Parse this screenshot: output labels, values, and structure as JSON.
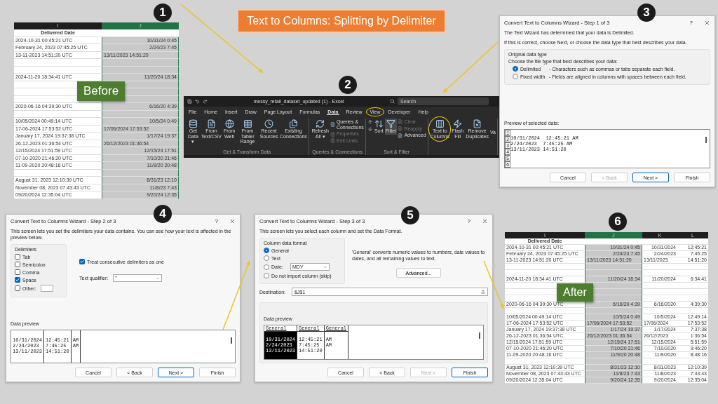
{
  "before": {
    "step": "1",
    "badge": "Before",
    "columns": [
      {
        "name": "I",
        "selected": false
      },
      {
        "name": "J",
        "selected": true
      }
    ],
    "header": "Delivered Date",
    "rows": [
      {
        "kind": "data",
        "cells": [
          {
            "text": "2024-10-31 00:45:21 UTC",
            "kind": "text"
          },
          {
            "text": "10/31/24 0:45",
            "kind": "number"
          }
        ]
      },
      {
        "kind": "data",
        "cells": [
          {
            "text": "February 24, 2023 07:45:25 UTC",
            "kind": "text"
          },
          {
            "text": "2/24/23 7:45",
            "kind": "number"
          }
        ]
      },
      {
        "kind": "data",
        "cells": [
          {
            "text": "13-11-2023 14:51:20 UTC",
            "kind": "text"
          },
          {
            "text": "13/11/2023 14:51:20",
            "kind": "text"
          }
        ]
      },
      {
        "kind": "blank"
      },
      {
        "kind": "blank"
      },
      {
        "kind": "data",
        "cells": [
          {
            "text": "2024-11-20 18:34:41 UTC",
            "kind": "text"
          },
          {
            "text": "11/20/24 18:34",
            "kind": "number"
          }
        ]
      },
      {
        "kind": "blank"
      },
      {
        "kind": "blank"
      },
      {
        "kind": "blank"
      },
      {
        "kind": "data",
        "cells": [
          {
            "text": "2020-06-16 04:39:30 UTC",
            "kind": "text"
          },
          {
            "text": "6/16/20 4:39",
            "kind": "number"
          }
        ]
      },
      {
        "kind": "blank"
      },
      {
        "kind": "data",
        "cells": [
          {
            "text": "10/05/2024 00:49:14 UTC",
            "kind": "text"
          },
          {
            "text": "10/5/24 0:49",
            "kind": "number"
          }
        ]
      },
      {
        "kind": "data",
        "cells": [
          {
            "text": "17-06-2024 17:53:52 UTC",
            "kind": "text"
          },
          {
            "text": "17/06/2024 17:53:52",
            "kind": "text"
          }
        ]
      },
      {
        "kind": "data",
        "cells": [
          {
            "text": "January 17, 2024 19:37:38 UTC",
            "kind": "text"
          },
          {
            "text": "1/17/24 19:37",
            "kind": "number"
          }
        ]
      },
      {
        "kind": "data",
        "cells": [
          {
            "text": "26-12-2023 01:36:54 UTC",
            "kind": "text"
          },
          {
            "text": "26/12/2023 01:36:54",
            "kind": "text"
          }
        ]
      },
      {
        "kind": "data",
        "cells": [
          {
            "text": "12/15/2024 17:51:59 UTC",
            "kind": "text"
          },
          {
            "text": "12/15/24 17:51",
            "kind": "number"
          }
        ]
      },
      {
        "kind": "data",
        "cells": [
          {
            "text": "07-10-2020 21:46:20 UTC",
            "kind": "text"
          },
          {
            "text": "7/10/20 21:46",
            "kind": "number"
          }
        ]
      },
      {
        "kind": "data",
        "cells": [
          {
            "text": "11-09-2020 20:48:16 UTC",
            "kind": "text"
          },
          {
            "text": "11/9/20 20:48",
            "kind": "number"
          }
        ]
      },
      {
        "kind": "blank"
      },
      {
        "kind": "data",
        "cells": [
          {
            "text": "August 31, 2023 12:10:39 UTC",
            "kind": "text"
          },
          {
            "text": "8/31/23 12:10",
            "kind": "number"
          }
        ]
      },
      {
        "kind": "data",
        "cells": [
          {
            "text": "November 08, 2023 07:43:43 UTC",
            "kind": "text"
          },
          {
            "text": "11/8/23 7:43",
            "kind": "number"
          }
        ]
      },
      {
        "kind": "data",
        "cells": [
          {
            "text": "09/20/2024 12:35:04 UTC",
            "kind": "text"
          },
          {
            "text": "9/20/24 12:35",
            "kind": "number"
          }
        ]
      }
    ]
  },
  "title": "Text to Columns: Splitting by Delimiter",
  "excel": {
    "step": "2",
    "window_title": "messy_retail_dataset_updated (1) - Excel",
    "search_placeholder": "Search",
    "tabs": [
      {
        "label": "File",
        "selected": false,
        "highlighted": false
      },
      {
        "label": "Home",
        "selected": false,
        "highlighted": false
      },
      {
        "label": "Insert",
        "selected": false,
        "highlighted": false
      },
      {
        "label": "Draw",
        "selected": false,
        "highlighted": false
      },
      {
        "label": "Page Layout",
        "selected": false,
        "highlighted": false
      },
      {
        "label": "Formulas",
        "selected": false,
        "highlighted": false
      },
      {
        "label": "Data",
        "selected": true,
        "highlighted": false
      },
      {
        "label": "Review",
        "selected": false,
        "highlighted": false
      },
      {
        "label": "View",
        "selected": false,
        "highlighted": true
      },
      {
        "label": "Developer",
        "selected": false,
        "highlighted": false
      },
      {
        "label": "Help",
        "selected": false,
        "highlighted": false
      }
    ],
    "groups": [
      {
        "label": "Get & Transform Data",
        "items": [
          {
            "kind": "large",
            "label": "Get Data ▾",
            "selected": false,
            "disabled": false,
            "highlighted": false
          },
          {
            "kind": "large",
            "label": "From Text/CSV",
            "selected": false,
            "disabled": false,
            "highlighted": false
          },
          {
            "kind": "large",
            "label": "From Web",
            "selected": false,
            "disabled": false,
            "highlighted": false
          },
          {
            "kind": "large",
            "label": "From Table/ Range",
            "selected": false,
            "disabled": false,
            "highlighted": false
          },
          {
            "kind": "large",
            "label": "Recent Sources",
            "selected": false,
            "disabled": false,
            "highlighted": false
          },
          {
            "kind": "large",
            "label": "Existing Connections",
            "selected": false,
            "disabled": false,
            "highlighted": false
          }
        ]
      },
      {
        "label": "Queries & Connections",
        "items": [
          {
            "kind": "large",
            "label": "Refresh All ▾",
            "selected": false,
            "disabled": false,
            "highlighted": false
          },
          {
            "kind": "stack",
            "entries": [
              {
                "label": "Queries & Connections",
                "disabled": false
              },
              {
                "label": "Properties",
                "disabled": true
              },
              {
                "label": "Edit Links",
                "disabled": true
              }
            ]
          }
        ]
      },
      {
        "label": "Sort & Filter",
        "items": [
          {
            "kind": "sort_buttons"
          },
          {
            "kind": "large",
            "label": "Sort",
            "selected": false,
            "disabled": false,
            "highlighted": false
          },
          {
            "kind": "large",
            "label": "Filter",
            "selected": true,
            "disabled": false,
            "highlighted": false
          },
          {
            "kind": "stack",
            "entries": [
              {
                "label": "Clear",
                "disabled": true
              },
              {
                "label": "Reapply",
                "disabled": true
              },
              {
                "label": "Advanced",
                "disabled": false
              }
            ]
          }
        ]
      },
      {
        "items": [
          {
            "kind": "large",
            "label": "Text to Columns",
            "selected": false,
            "disabled": false,
            "highlighted": true
          },
          {
            "kind": "large",
            "label": "Flash Fill",
            "selected": false,
            "disabled": false,
            "highlighted": false
          },
          {
            "kind": "large",
            "label": "Remove Duplicates",
            "selected": false,
            "disabled": false,
            "highlighted": false
          },
          {
            "kind": "cut",
            "label": "Va"
          }
        ]
      }
    ]
  },
  "step1_dialog": {
    "step": "3",
    "title": "Convert Text to Columns Wizard - Step 1 of 3",
    "help": "?",
    "intro": [
      "The Text Wizard has determined that your data is Delimited.",
      "If this is correct, choose Next, or choose the data type that best describes your data."
    ],
    "group_label": "Original data type",
    "prompt": "Choose the file type that best describes your data:",
    "options": [
      {
        "label": "Delimited",
        "description": "- Characters such as commas or tabs separate each field.",
        "selected": true
      },
      {
        "label": "Fixed width",
        "description": "- Fields are aligned in columns with spaces between each field.",
        "selected": false
      }
    ],
    "preview_label": "Preview of selected data:",
    "preview_lines": [
      {
        "number": "1"
      },
      {
        "number": "2",
        "text": "10/31/2024  12:45:21 AM"
      },
      {
        "number": "3",
        "text": "2/24/2023  7:45:25 AM"
      },
      {
        "number": "4",
        "text": "13/11/2023 14:51:20"
      },
      {
        "number": "5"
      },
      {
        "number": "6"
      }
    ],
    "buttons": [
      {
        "label": "Cancel",
        "disabled": false,
        "default": false
      },
      {
        "label": "< Back",
        "disabled": true,
        "default": false
      },
      {
        "label": "Next >",
        "disabled": false,
        "default": true
      },
      {
        "label": "Finish",
        "disabled": false,
        "default": false
      }
    ]
  },
  "step2_dialog": {
    "step": "4",
    "title": "Convert Text to Columns Wizard - Step 2 of 3",
    "help": "?",
    "intro": "This screen lets you set the delimiters your data contains.  You can see how your text is affected in the preview below.",
    "group_label": "Delimiters",
    "delimiters": [
      {
        "label": "Tab",
        "checked": false,
        "kind": "plain"
      },
      {
        "label": "Semicolon",
        "checked": false,
        "kind": "plain"
      },
      {
        "label": "Comma",
        "checked": false,
        "kind": "plain"
      },
      {
        "label": "Space",
        "checked": true,
        "kind": "plain"
      },
      {
        "label": "Other:",
        "checked": false,
        "kind": "other"
      }
    ],
    "consecutive": {
      "label": "Treat consecutive delimiters as one",
      "checked": true
    },
    "qualifier": {
      "label": "Text qualifier:",
      "value": "\""
    },
    "preview_label": "Data preview",
    "preview_columns": [
      [
        "10/31/2024",
        "2/24/2023",
        "13/11/2023"
      ],
      [
        "12:45:21",
        "7:45:25",
        "14:51:20"
      ],
      [
        "AM",
        "AM"
      ]
    ],
    "buttons": [
      {
        "label": "Cancel",
        "disabled": false,
        "default": false
      },
      {
        "label": "< Back",
        "disabled": false,
        "default": false
      },
      {
        "label": "Next >",
        "disabled": false,
        "default": true
      },
      {
        "label": "Finish",
        "disabled": false,
        "default": false
      }
    ]
  },
  "step3_dialog": {
    "step": "5",
    "title": "Convert Text to Columns Wizard - Step 3 of 3",
    "help": "?",
    "intro": "This screen lets you select each column and set the Data Format.",
    "group_label": "Column data format",
    "formats": [
      {
        "label": "General",
        "selected": true,
        "kind": "plain"
      },
      {
        "label": "Text",
        "selected": false,
        "kind": "plain"
      },
      {
        "label": "Date:",
        "selected": false,
        "kind": "date",
        "value": "MDY"
      },
      {
        "label": "Do not import column (skip)",
        "selected": false,
        "kind": "plain"
      }
    ],
    "note": "'General' converts numeric values to numbers, date values to dates, and all remaining values to text.",
    "advanced": "Advanced...",
    "destination": {
      "label": "Destination:",
      "value": "$J$1"
    },
    "preview_label": "Data preview",
    "preview_columns": [
      {
        "header": "General",
        "selected": true,
        "values": [
          "10/31/2024",
          "2/24/2023",
          "13/11/2023"
        ]
      },
      {
        "header": "General",
        "selected": false,
        "values": [
          "12:45:21",
          "7:45:25",
          "14:51:20"
        ]
      },
      {
        "header": "General",
        "selected": false,
        "values": [
          "AM",
          "AM"
        ]
      }
    ],
    "buttons": [
      {
        "label": "Cancel",
        "disabled": false,
        "default": false
      },
      {
        "label": "< Back",
        "disabled": false,
        "default": false
      },
      {
        "label": "Next >",
        "disabled": true,
        "default": false
      },
      {
        "label": "Finish",
        "disabled": false,
        "default": true
      }
    ]
  },
  "after": {
    "step": "6",
    "badge": "After",
    "columns": [
      {
        "name": "I",
        "selected": false
      },
      {
        "name": "J",
        "selected": true
      },
      {
        "name": "K",
        "selected": false
      },
      {
        "name": "L",
        "selected": false
      }
    ],
    "header": "Delivered Date",
    "rows": [
      {
        "kind": "data",
        "cells": [
          {
            "text": "2024-10-31 00:45:21 UTC",
            "kind": "text"
          },
          {
            "text": "10/31/24 0:45",
            "kind": "number"
          },
          {
            "text": "10/31/2024",
            "kind": "number"
          },
          {
            "text": "12:45:21",
            "kind": "number"
          }
        ]
      },
      {
        "kind": "data",
        "cells": [
          {
            "text": "February 24, 2023 07:45:25 UTC",
            "kind": "text"
          },
          {
            "text": "2/24/23 7:45",
            "kind": "number"
          },
          {
            "text": "2/24/2023",
            "kind": "number"
          },
          {
            "text": "7:45:25",
            "kind": "number"
          }
        ]
      },
      {
        "kind": "data",
        "cells": [
          {
            "text": "13-11-2023 14:51:20 UTC",
            "kind": "text"
          },
          {
            "text": "13/11/2023 14:51:20",
            "kind": "text"
          },
          {
            "text": "13/11/2023",
            "kind": "text"
          },
          {
            "text": "14:51:20",
            "kind": "number"
          }
        ]
      },
      {
        "kind": "blank"
      },
      {
        "kind": "blank"
      },
      {
        "kind": "data",
        "cells": [
          {
            "text": "2024-11-20 18:34:41 UTC",
            "kind": "text"
          },
          {
            "text": "11/20/24 18:34",
            "kind": "number"
          },
          {
            "text": "11/20/2024",
            "kind": "number"
          },
          {
            "text": "6:34:41",
            "kind": "number"
          }
        ]
      },
      {
        "kind": "blank"
      },
      {
        "kind": "blank"
      },
      {
        "kind": "blank"
      },
      {
        "kind": "data",
        "cells": [
          {
            "text": "2020-06-16 04:39:30 UTC",
            "kind": "text"
          },
          {
            "text": "6/16/20 4:39",
            "kind": "number"
          },
          {
            "text": "6/16/2020",
            "kind": "number"
          },
          {
            "text": "4:39:30",
            "kind": "number"
          }
        ]
      },
      {
        "kind": "blank"
      },
      {
        "kind": "data",
        "cells": [
          {
            "text": "10/05/2024 00:49:14 UTC",
            "kind": "text"
          },
          {
            "text": "10/5/24 0:49",
            "kind": "number"
          },
          {
            "text": "10/5/2024",
            "kind": "number"
          },
          {
            "text": "12:49:14",
            "kind": "number"
          }
        ]
      },
      {
        "kind": "data",
        "cells": [
          {
            "text": "17-06-2024 17:53:52 UTC",
            "kind": "text"
          },
          {
            "text": "17/06/2024 17:53:52",
            "kind": "text"
          },
          {
            "text": "17/06/2024",
            "kind": "text"
          },
          {
            "text": "17:53:52",
            "kind": "number"
          }
        ]
      },
      {
        "kind": "data",
        "cells": [
          {
            "text": "January 17, 2024 19:37:38 UTC",
            "kind": "text"
          },
          {
            "text": "1/17/24 19:37",
            "kind": "number"
          },
          {
            "text": "1/17/2024",
            "kind": "number"
          },
          {
            "text": "7:37:38",
            "kind": "number"
          }
        ]
      },
      {
        "kind": "data",
        "cells": [
          {
            "text": "26-12-2023 01:36:54 UTC",
            "kind": "text"
          },
          {
            "text": "26/12/2023 01:36:54",
            "kind": "text"
          },
          {
            "text": "26/12/2023",
            "kind": "text"
          },
          {
            "text": "1:36:54",
            "kind": "number"
          }
        ]
      },
      {
        "kind": "data",
        "cells": [
          {
            "text": "12/15/2024 17:51:59 UTC",
            "kind": "text"
          },
          {
            "text": "12/15/24 17:51",
            "kind": "number"
          },
          {
            "text": "12/15/2024",
            "kind": "number"
          },
          {
            "text": "5:51:59",
            "kind": "number"
          }
        ]
      },
      {
        "kind": "data",
        "cells": [
          {
            "text": "07-10-2020 21:46:20 UTC",
            "kind": "text"
          },
          {
            "text": "7/10/20 21:46",
            "kind": "number"
          },
          {
            "text": "7/10/2020",
            "kind": "number"
          },
          {
            "text": "9:46:20",
            "kind": "number"
          }
        ]
      },
      {
        "kind": "data",
        "cells": [
          {
            "text": "11-09-2020 20:48:16 UTC",
            "kind": "text"
          },
          {
            "text": "11/9/20 20:48",
            "kind": "number"
          },
          {
            "text": "11/9/2020",
            "kind": "number"
          },
          {
            "text": "8:48:16",
            "kind": "number"
          }
        ]
      },
      {
        "kind": "blank"
      },
      {
        "kind": "data",
        "cells": [
          {
            "text": "August 31, 2023 12:10:39 UTC",
            "kind": "text"
          },
          {
            "text": "8/31/23 12:10",
            "kind": "number"
          },
          {
            "text": "8/31/2023",
            "kind": "number"
          },
          {
            "text": "12:10:39",
            "kind": "number"
          }
        ]
      },
      {
        "kind": "data",
        "cells": [
          {
            "text": "November 08, 2023 07:43:43 UTC",
            "kind": "text"
          },
          {
            "text": "11/8/23 7:43",
            "kind": "number"
          },
          {
            "text": "11/8/2023",
            "kind": "number"
          },
          {
            "text": "7:43:43",
            "kind": "number"
          }
        ]
      },
      {
        "kind": "data",
        "cells": [
          {
            "text": "09/20/2024 12:35:04 UTC",
            "kind": "text"
          },
          {
            "text": "9/20/24 12:35",
            "kind": "number"
          },
          {
            "text": "9/20/2024",
            "kind": "number"
          },
          {
            "text": "12:35:04",
            "kind": "number"
          }
        ]
      }
    ]
  }
}
